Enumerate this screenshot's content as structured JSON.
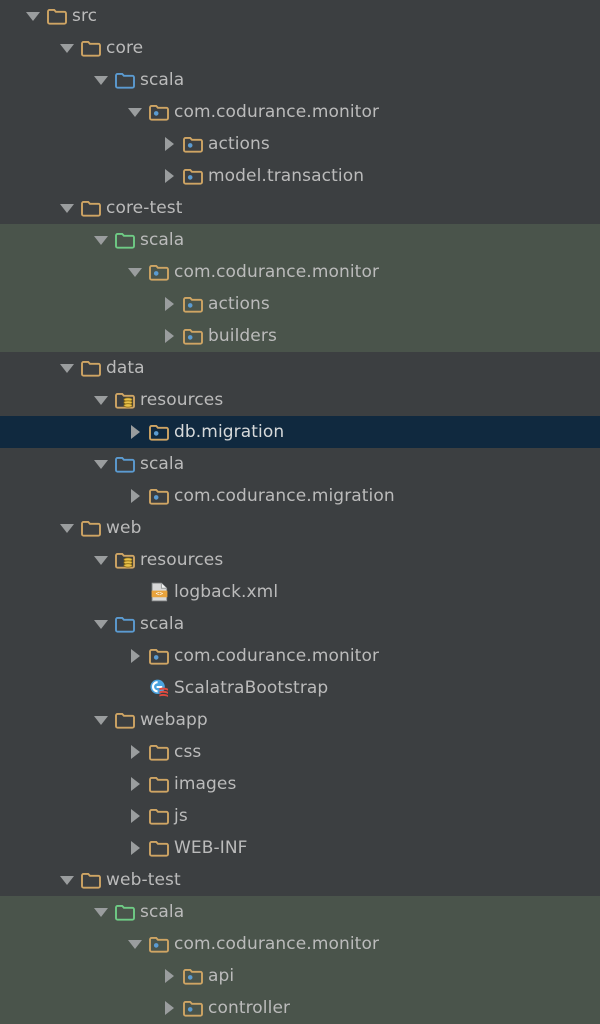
{
  "panel": {
    "name": "project-tree",
    "colors": {
      "background": "#3c3f41",
      "test_source_tint": "#4a544b",
      "selection": "#10293f",
      "text": "#bbbbbb",
      "folder_plain": "#c9a66b",
      "folder_sources_root": "#5394c4",
      "folder_test_sources_root": "#69c17c",
      "package_dot": "#5394c4",
      "arrow": "#9a9d9e"
    }
  },
  "rows": [
    {
      "label": "src",
      "depth": 0,
      "arrow": "down",
      "icon": "folder-plain",
      "state": "normal"
    },
    {
      "label": "core",
      "depth": 1,
      "arrow": "down",
      "icon": "folder-plain",
      "state": "normal"
    },
    {
      "label": "scala",
      "depth": 2,
      "arrow": "down",
      "icon": "folder-sources-root",
      "state": "normal"
    },
    {
      "label": "com.codurance.monitor",
      "depth": 3,
      "arrow": "down",
      "icon": "folder-package",
      "state": "normal"
    },
    {
      "label": "actions",
      "depth": 4,
      "arrow": "right",
      "icon": "folder-package",
      "state": "normal"
    },
    {
      "label": "model.transaction",
      "depth": 4,
      "arrow": "right",
      "icon": "folder-package",
      "state": "normal"
    },
    {
      "label": "core-test",
      "depth": 1,
      "arrow": "down",
      "icon": "folder-plain",
      "state": "normal"
    },
    {
      "label": "scala",
      "depth": 2,
      "arrow": "down",
      "icon": "folder-test-root",
      "state": "test"
    },
    {
      "label": "com.codurance.monitor",
      "depth": 3,
      "arrow": "down",
      "icon": "folder-package",
      "state": "test"
    },
    {
      "label": "actions",
      "depth": 4,
      "arrow": "right",
      "icon": "folder-package",
      "state": "test"
    },
    {
      "label": "builders",
      "depth": 4,
      "arrow": "right",
      "icon": "folder-package",
      "state": "test"
    },
    {
      "label": "data",
      "depth": 1,
      "arrow": "down",
      "icon": "folder-plain",
      "state": "normal"
    },
    {
      "label": "resources",
      "depth": 2,
      "arrow": "down",
      "icon": "folder-resources",
      "state": "normal"
    },
    {
      "label": "db.migration",
      "depth": 3,
      "arrow": "right",
      "icon": "folder-package",
      "state": "selected"
    },
    {
      "label": "scala",
      "depth": 2,
      "arrow": "down",
      "icon": "folder-sources-root",
      "state": "normal"
    },
    {
      "label": "com.codurance.migration",
      "depth": 3,
      "arrow": "right",
      "icon": "folder-package",
      "state": "normal"
    },
    {
      "label": "web",
      "depth": 1,
      "arrow": "down",
      "icon": "folder-plain",
      "state": "normal"
    },
    {
      "label": "resources",
      "depth": 2,
      "arrow": "down",
      "icon": "folder-resources",
      "state": "normal"
    },
    {
      "label": "logback.xml",
      "depth": 3,
      "arrow": "none",
      "icon": "file-xml",
      "state": "normal"
    },
    {
      "label": "scala",
      "depth": 2,
      "arrow": "down",
      "icon": "folder-sources-root",
      "state": "normal"
    },
    {
      "label": "com.codurance.monitor",
      "depth": 3,
      "arrow": "right",
      "icon": "folder-package",
      "state": "normal"
    },
    {
      "label": "ScalatraBootstrap",
      "depth": 3,
      "arrow": "none",
      "icon": "file-scala-class",
      "state": "normal"
    },
    {
      "label": "webapp",
      "depth": 2,
      "arrow": "down",
      "icon": "folder-plain",
      "state": "normal"
    },
    {
      "label": "css",
      "depth": 3,
      "arrow": "right",
      "icon": "folder-plain",
      "state": "normal"
    },
    {
      "label": "images",
      "depth": 3,
      "arrow": "right",
      "icon": "folder-plain",
      "state": "normal"
    },
    {
      "label": "js",
      "depth": 3,
      "arrow": "right",
      "icon": "folder-plain",
      "state": "normal"
    },
    {
      "label": "WEB-INF",
      "depth": 3,
      "arrow": "right",
      "icon": "folder-plain",
      "state": "normal"
    },
    {
      "label": "web-test",
      "depth": 1,
      "arrow": "down",
      "icon": "folder-plain",
      "state": "normal"
    },
    {
      "label": "scala",
      "depth": 2,
      "arrow": "down",
      "icon": "folder-test-root",
      "state": "test"
    },
    {
      "label": "com.codurance.monitor",
      "depth": 3,
      "arrow": "down",
      "icon": "folder-package",
      "state": "test"
    },
    {
      "label": "api",
      "depth": 4,
      "arrow": "right",
      "icon": "folder-package",
      "state": "test"
    },
    {
      "label": "controller",
      "depth": 4,
      "arrow": "right",
      "icon": "folder-package",
      "state": "test"
    }
  ]
}
